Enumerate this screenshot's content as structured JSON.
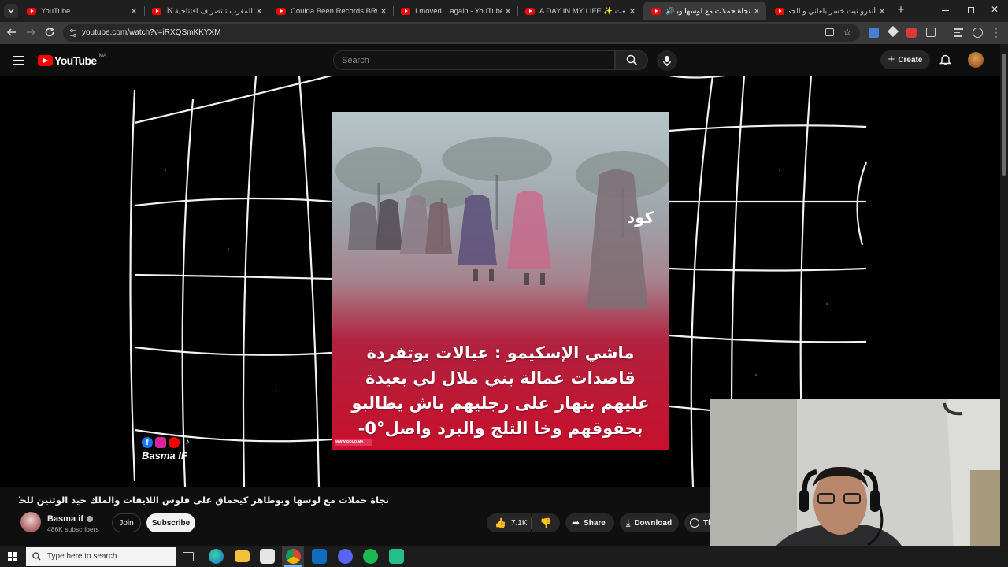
{
  "browser": {
    "tabs": [
      {
        "title": "YouTube",
        "active": false
      },
      {
        "title": "المغرب تنتصر ف افتتاحية كأس الأ",
        "active": false
      },
      {
        "title": "Coulda Been Records BROOKLY",
        "active": false
      },
      {
        "title": "I moved... again - YouTube",
        "active": false
      },
      {
        "title": "A DAY IN MY LIFE ✨ شعري نعت",
        "active": false
      },
      {
        "title": "نجاة حملات مع لوسها وبوطا",
        "active": true
      },
      {
        "title": "أندرو تيت خسر بلعاني و الجمهور",
        "active": false
      }
    ],
    "url": "youtube.com/watch?v=iRXQSmKKYXM"
  },
  "youtube": {
    "logo_text": "YouTube",
    "country_code": "MA",
    "search_placeholder": "Search",
    "create_label": "Create"
  },
  "video": {
    "caption_lines": [
      "ماشي الإسكيمو : عيالات بوتفردة",
      "قاصدات عمالة بني ملال لي بعيدة",
      "عليهم بنهار على رجليهم باش يطالبو",
      "بحقوقهم وخا الثلج والبرد واصل°0-"
    ],
    "brand_logo": "كود",
    "source_tag": "www.goud.ma",
    "watermark": "Basma IF"
  },
  "details": {
    "title": "نجاة حملات مع لوسها وبوطاهر كيحماق على فلوس اللايفات والملك جيد الوتنين للحكومة بسبب الناس دآسفي",
    "channel_name": "Basma if",
    "subscribers": "486K subscribers",
    "join_label": "Join",
    "subscribe_label": "Subscribe",
    "like_count": "7.1K",
    "share_label": "Share",
    "download_label": "Download",
    "thanks_label": "Th"
  },
  "taskbar": {
    "search_placeholder": "Type here to search"
  },
  "colors": {
    "brand_red": "#ff0000",
    "background": "#0f0f0f",
    "tab_active": "#3a3a3a"
  }
}
